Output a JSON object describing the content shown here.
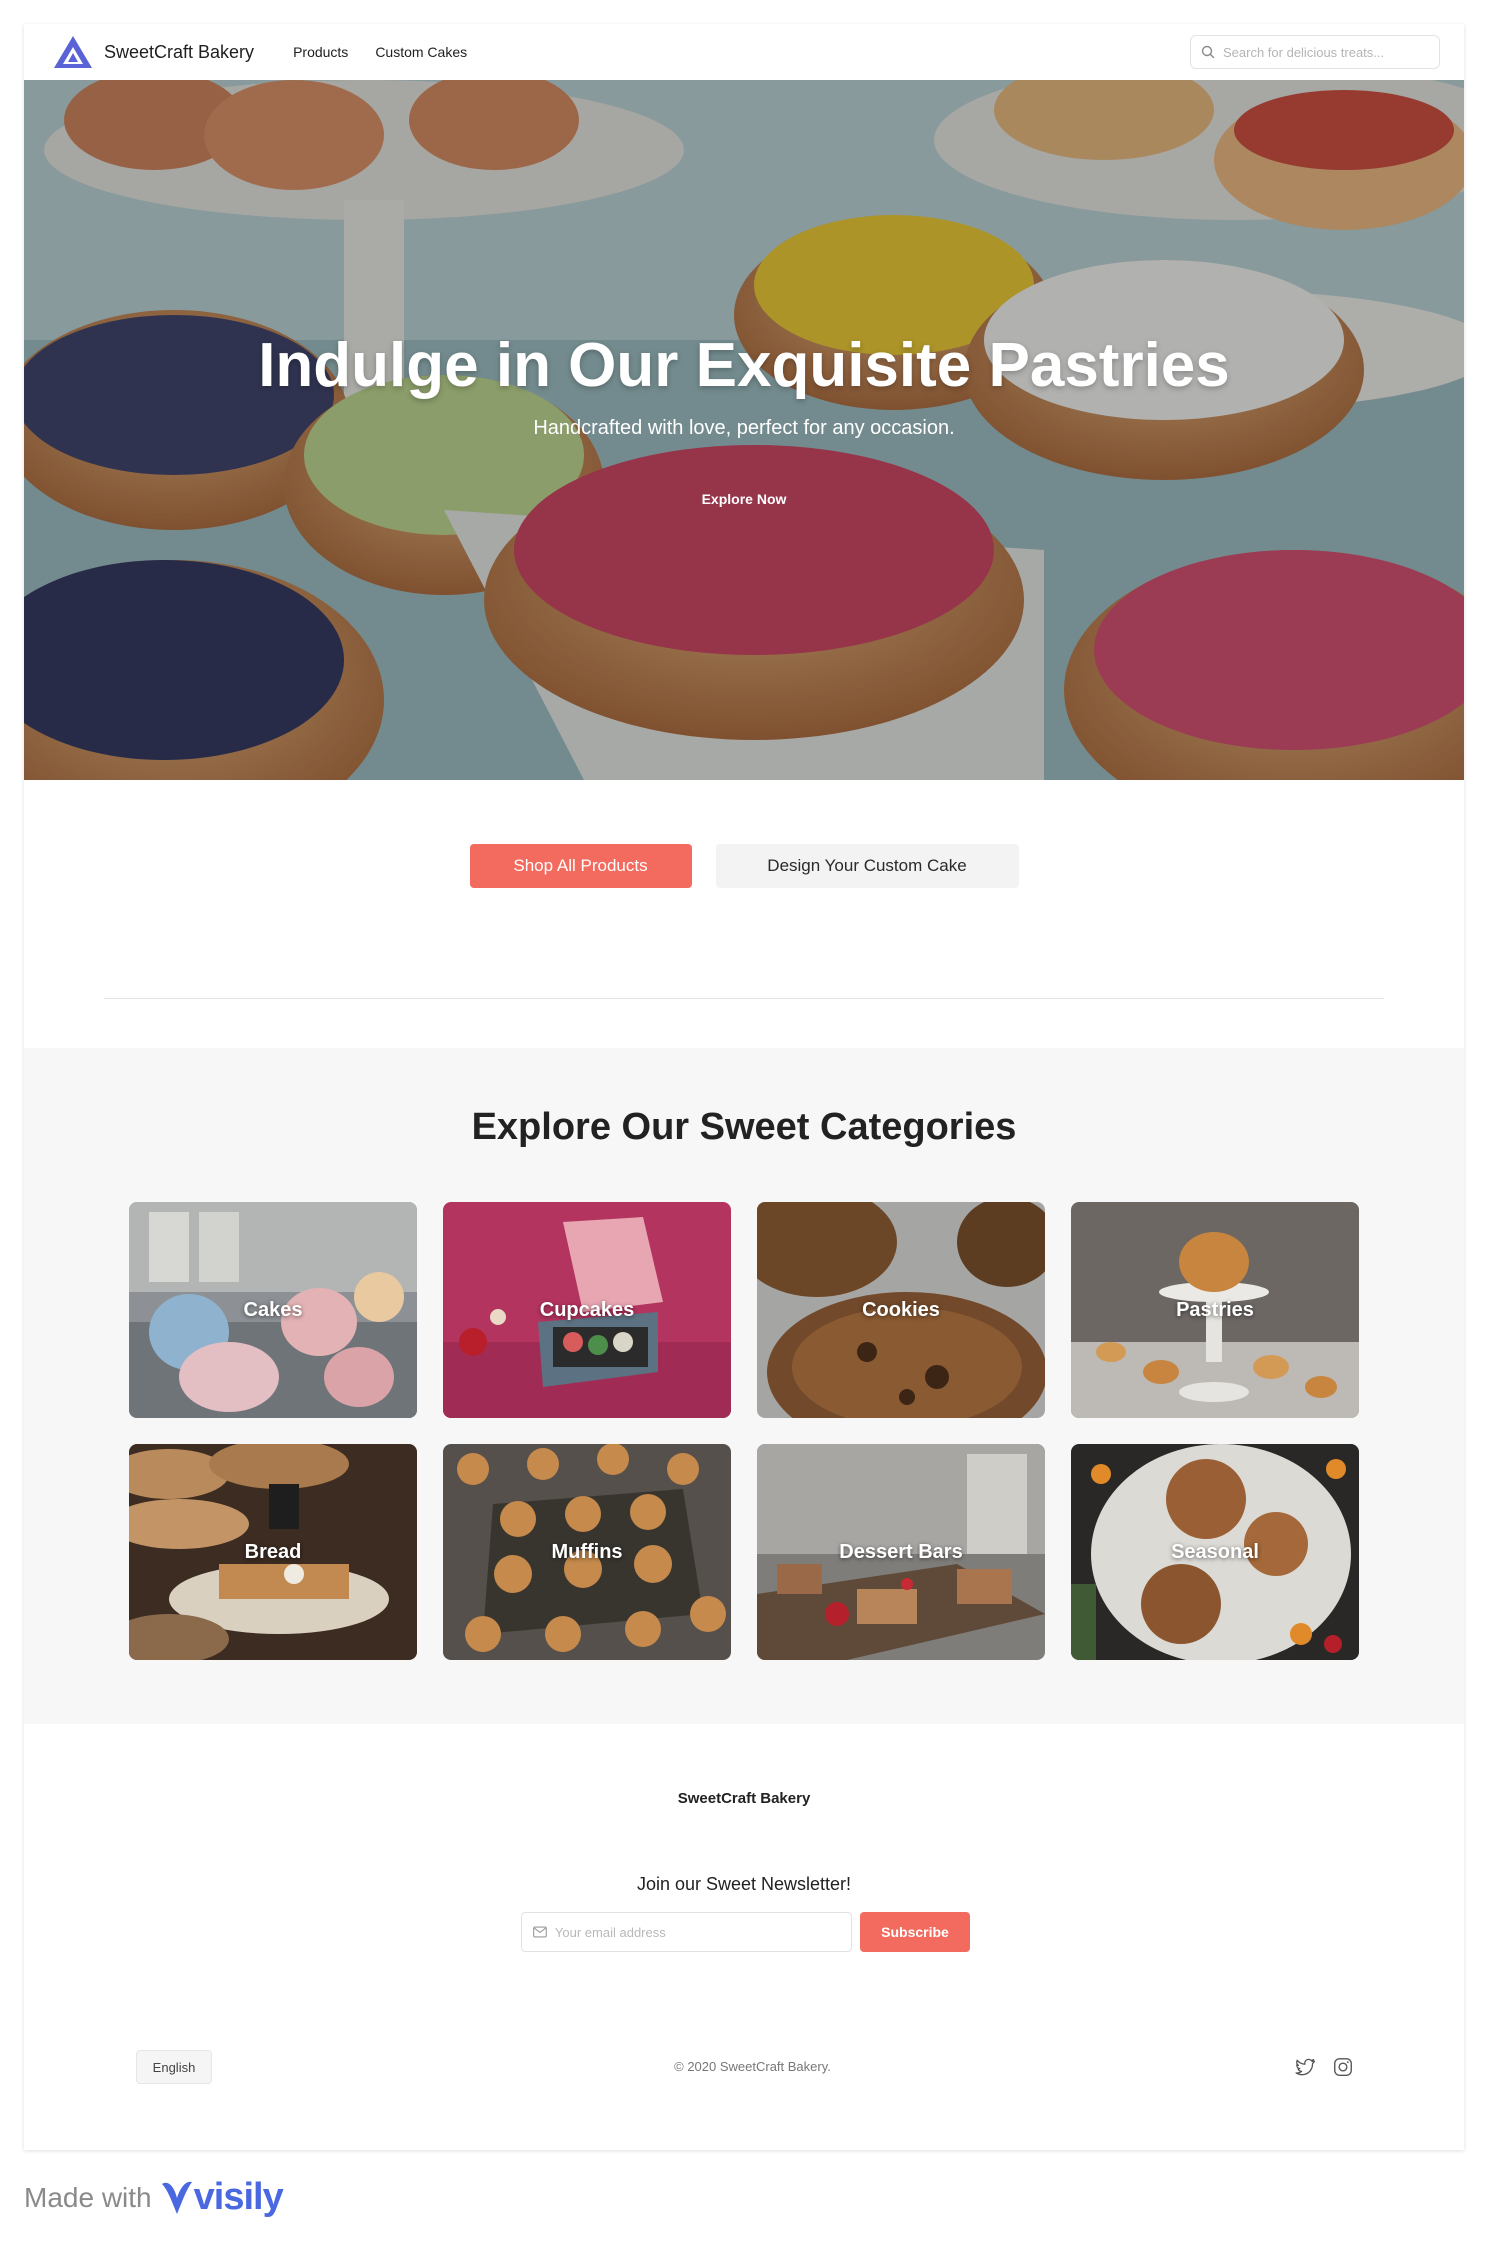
{
  "nav": {
    "brand": "SweetCraft Bakery",
    "links": [
      "Products",
      "Custom Cakes"
    ],
    "search_placeholder": "Search for delicious treats...",
    "icons": {
      "logo": "triangle-logo-icon",
      "search": "search-icon"
    }
  },
  "hero": {
    "title": "Indulge in Our Exquisite Pastries",
    "subtitle": "Handcrafted with love, perfect for any occasion.",
    "cta": "Explore Now"
  },
  "actions": {
    "shop_all": "Shop All Products",
    "custom_cake": "Design Your Custom Cake"
  },
  "categories": {
    "title": "Explore Our Sweet Categories",
    "items": [
      {
        "label": "Cakes"
      },
      {
        "label": "Cupcakes"
      },
      {
        "label": "Cookies"
      },
      {
        "label": "Pastries"
      },
      {
        "label": "Bread"
      },
      {
        "label": "Muffins"
      },
      {
        "label": "Dessert Bars"
      },
      {
        "label": "Seasonal"
      }
    ]
  },
  "footer": {
    "brand": "SweetCraft Bakery",
    "newsletter_title": "Join our Sweet Newsletter!",
    "email_placeholder": "Your email address",
    "subscribe": "Subscribe",
    "language": "English",
    "copyright": "© 2020 SweetCraft Bakery.",
    "social_icons": [
      "twitter-icon",
      "instagram-icon"
    ]
  },
  "made_with": {
    "text": "Made with",
    "brand": "visily"
  },
  "colors": {
    "accent": "#f36a5e",
    "logo": "#5a63d6",
    "category_bg": "#f7f7f7",
    "visily": "#4a68e0"
  }
}
